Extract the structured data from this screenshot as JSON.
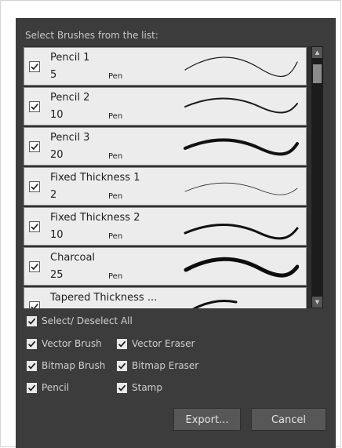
{
  "header": {
    "label": "Select Brushes from the list:"
  },
  "brushes": [
    {
      "name": "Pencil 1",
      "size": "5",
      "type": "Pen",
      "checked": true
    },
    {
      "name": "Pencil 2",
      "size": "10",
      "type": "Pen",
      "checked": true
    },
    {
      "name": "Pencil 3",
      "size": "20",
      "type": "Pen",
      "checked": true
    },
    {
      "name": "Fixed Thickness 1",
      "size": "2",
      "type": "Pen",
      "checked": true
    },
    {
      "name": "Fixed Thickness 2",
      "size": "10",
      "type": "Pen",
      "checked": true
    },
    {
      "name": "Charcoal",
      "size": "25",
      "type": "Pen",
      "checked": true
    },
    {
      "name": "Tapered Thickness ...",
      "size": "",
      "type": "",
      "checked": true
    }
  ],
  "options": {
    "select_all": "Select/ Deselect All",
    "vector_brush": "Vector Brush",
    "vector_eraser": "Vector Eraser",
    "bitmap_brush": "Bitmap Brush",
    "bitmap_eraser": "Bitmap Eraser",
    "pencil": "Pencil",
    "stamp": "Stamp"
  },
  "buttons": {
    "export": "Export...",
    "cancel": "Cancel"
  },
  "icons": {
    "check": "check-icon",
    "scroll_up": "scroll-up-arrow-icon",
    "scroll_down": "scroll-down-arrow-icon"
  },
  "colors": {
    "dialog_bg": "#3c3c3c",
    "row_bg": "#ececec",
    "button_bg": "#575757"
  }
}
